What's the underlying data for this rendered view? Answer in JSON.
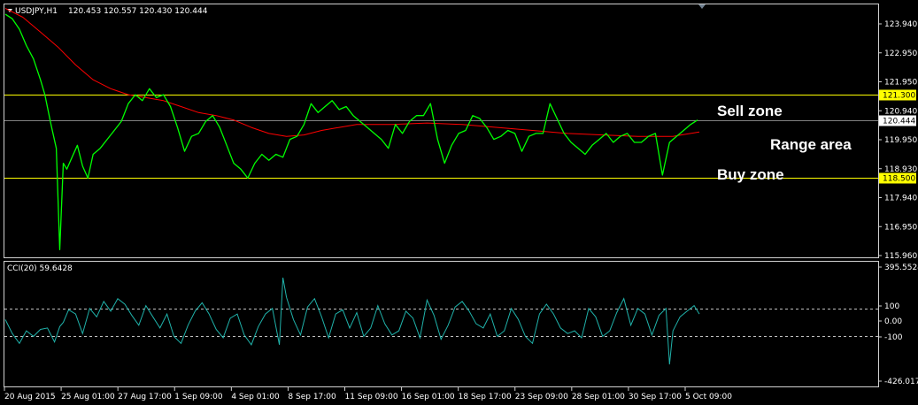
{
  "header": {
    "symbol": "USDJPY,H1",
    "ohlc": "120.453 120.557 120.430 120.444",
    "indicator": "CCI(20) 59.6428"
  },
  "colors": {
    "background": "#000000",
    "price_line": "#00ff00",
    "ma_line": "#ff0000",
    "cci_line": "#20b2aa",
    "zone_line": "#ffff00",
    "current_line": "#808080",
    "tag_yellow": "#ffff00",
    "tag_white": "#ffffff"
  },
  "annotations": {
    "sell_zone": "Sell zone",
    "range_area": "Range area",
    "buy_zone": "Buy zone"
  },
  "chart_data": [
    {
      "type": "line",
      "title": "USDJPY,H1",
      "ylim": [
        115.9,
        124.3
      ],
      "y_ticks": [
        "123.940",
        "122.950",
        "121.950",
        "120.940",
        "119.950",
        "118.930",
        "117.940",
        "116.950",
        "115.960"
      ],
      "x_ticks": [
        "20 Aug 2015",
        "25 Aug 01:00",
        "27 Aug 17:00",
        "1 Sep 09:00",
        "4 Sep 01:00",
        "8 Sep 17:00",
        "11 Sep 09:00",
        "16 Sep 01:00",
        "18 Sep 17:00",
        "23 Sep 09:00",
        "28 Sep 01:00",
        "30 Sep 17:00",
        "5 Oct 09:00"
      ],
      "levels": [
        {
          "value": 121.3,
          "label": "121.300",
          "role": "sell_zone"
        },
        {
          "value": 120.444,
          "label": "120.444",
          "role": "current_price"
        },
        {
          "value": 118.5,
          "label": "118.500",
          "role": "buy_zone"
        }
      ],
      "series": [
        {
          "role": "price",
          "x": [
            0,
            8,
            16,
            24,
            32,
            40,
            45,
            52,
            58,
            62,
            66,
            70,
            76,
            82,
            88,
            94,
            100,
            108,
            116,
            124,
            132,
            140,
            148,
            156,
            164,
            172,
            180,
            188,
            196,
            204,
            212,
            220,
            228,
            236,
            244,
            252,
            260,
            268,
            276,
            284,
            292,
            300,
            308,
            316,
            324,
            332,
            340,
            348,
            356,
            364,
            372,
            380,
            388,
            396,
            404,
            412,
            420,
            428,
            436,
            444,
            452,
            460,
            468,
            476,
            484,
            492,
            500,
            508,
            516,
            524,
            532,
            540,
            548,
            556,
            564,
            572,
            580,
            588,
            596,
            604,
            612,
            620,
            628,
            636,
            644,
            652,
            660,
            668,
            676,
            684,
            692,
            700,
            708,
            716,
            724,
            732,
            740,
            748,
            756,
            764,
            772,
            780,
            788
          ],
          "y": [
            124.0,
            123.85,
            123.5,
            122.95,
            122.5,
            121.8,
            121.3,
            120.3,
            119.5,
            116.1,
            119.0,
            118.8,
            119.2,
            119.6,
            118.9,
            118.5,
            119.3,
            119.5,
            119.8,
            120.1,
            120.4,
            121.0,
            121.3,
            121.1,
            121.5,
            121.2,
            121.3,
            120.9,
            120.2,
            119.4,
            119.9,
            120.0,
            120.4,
            120.6,
            120.2,
            119.6,
            119.0,
            118.8,
            118.5,
            119.0,
            119.3,
            119.1,
            119.3,
            119.2,
            119.8,
            119.9,
            120.3,
            121.0,
            120.7,
            120.9,
            121.1,
            120.8,
            120.9,
            120.6,
            120.4,
            120.2,
            120.0,
            119.8,
            119.5,
            120.3,
            120.0,
            120.4,
            120.6,
            120.6,
            121.0,
            119.8,
            119.0,
            119.6,
            120.0,
            120.1,
            120.6,
            120.5,
            120.2,
            119.8,
            119.9,
            120.1,
            120.0,
            119.4,
            119.9,
            120.0,
            120.0,
            121.0,
            120.5,
            120.0,
            119.7,
            119.5,
            119.3,
            119.6,
            119.8,
            120.0,
            119.7,
            119.9,
            120.0,
            119.7,
            119.7,
            119.9,
            120.0,
            118.6,
            119.7,
            119.9,
            120.1,
            120.3,
            120.45
          ]
        },
        {
          "role": "moving_average",
          "x": [
            0,
            20,
            40,
            60,
            80,
            100,
            120,
            140,
            160,
            180,
            200,
            220,
            240,
            260,
            280,
            300,
            320,
            340,
            360,
            380,
            400,
            440,
            480,
            520,
            560,
            600,
            640,
            680,
            720,
            760,
            790
          ],
          "y": [
            124.2,
            123.9,
            123.4,
            122.9,
            122.3,
            121.8,
            121.5,
            121.3,
            121.2,
            121.1,
            120.9,
            120.7,
            120.6,
            120.45,
            120.2,
            120.0,
            119.9,
            119.95,
            120.1,
            120.2,
            120.3,
            120.3,
            120.35,
            120.3,
            120.2,
            120.1,
            120.0,
            119.95,
            119.9,
            119.9,
            120.05
          ]
        }
      ]
    },
    {
      "type": "line",
      "title": "CCI(20) 59.6428",
      "ylim": [
        -426.0176,
        395.5524
      ],
      "y_ticks": [
        "395.5524",
        "100",
        "0.00",
        "-100",
        "-426.0176"
      ],
      "levels": [
        100,
        -100
      ],
      "series": [
        {
          "role": "cci",
          "x": [
            0,
            8,
            16,
            24,
            32,
            40,
            48,
            56,
            62,
            66,
            72,
            80,
            88,
            96,
            104,
            112,
            120,
            128,
            136,
            144,
            152,
            160,
            168,
            176,
            184,
            192,
            200,
            208,
            216,
            224,
            232,
            240,
            248,
            256,
            264,
            272,
            280,
            288,
            296,
            304,
            312,
            316,
            320,
            328,
            336,
            344,
            352,
            360,
            368,
            376,
            384,
            392,
            400,
            408,
            416,
            424,
            432,
            440,
            448,
            456,
            464,
            472,
            480,
            488,
            496,
            504,
            512,
            520,
            528,
            536,
            544,
            552,
            560,
            568,
            576,
            584,
            592,
            600,
            608,
            616,
            624,
            632,
            640,
            648,
            656,
            664,
            672,
            680,
            688,
            696,
            704,
            712,
            720,
            728,
            736,
            744,
            752,
            756,
            760,
            768,
            776,
            784,
            790
          ],
          "y": [
            20,
            -80,
            -150,
            -60,
            -100,
            -50,
            -40,
            -140,
            -30,
            0,
            90,
            60,
            -80,
            100,
            40,
            150,
            80,
            170,
            130,
            50,
            -20,
            120,
            40,
            -40,
            60,
            -100,
            -150,
            -20,
            80,
            140,
            60,
            -50,
            -110,
            30,
            60,
            -90,
            -160,
            -30,
            60,
            100,
            -160,
            320,
            180,
            20,
            -90,
            110,
            170,
            40,
            -110,
            60,
            90,
            -40,
            70,
            -100,
            -40,
            120,
            -10,
            -90,
            -60,
            80,
            30,
            -110,
            160,
            50,
            -120,
            -20,
            110,
            150,
            80,
            -10,
            -40,
            60,
            -100,
            -60,
            100,
            20,
            -100,
            -150,
            60,
            130,
            60,
            -40,
            -80,
            -60,
            -110,
            100,
            40,
            -100,
            -60,
            70,
            170,
            -20,
            100,
            60,
            -90,
            50,
            100,
            -300,
            -60,
            40,
            80,
            120,
            60
          ]
        }
      ]
    }
  ]
}
